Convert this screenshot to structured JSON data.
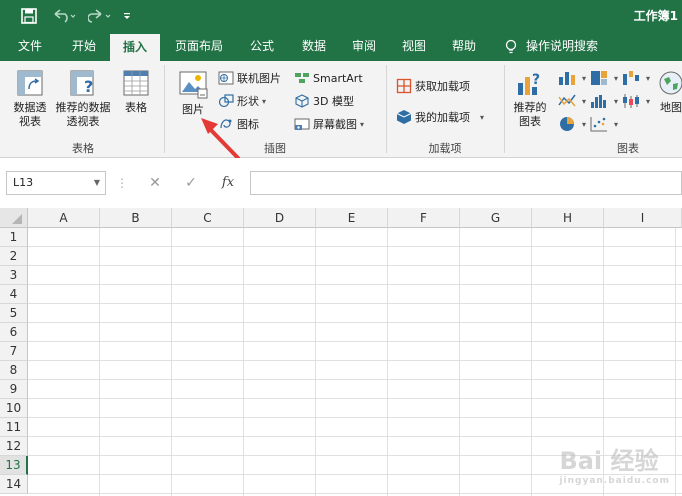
{
  "window": {
    "title": "工作簿1"
  },
  "tabs": [
    {
      "label": "文件"
    },
    {
      "label": "开始"
    },
    {
      "label": "插入"
    },
    {
      "label": "页面布局"
    },
    {
      "label": "公式"
    },
    {
      "label": "数据"
    },
    {
      "label": "审阅"
    },
    {
      "label": "视图"
    },
    {
      "label": "帮助"
    },
    {
      "label": "操作说明搜索"
    }
  ],
  "active_tab": "插入",
  "ribbon": {
    "tables": {
      "pivot": "数据透视表",
      "recommended_pivot": "推荐的数据透视表",
      "table": "表格",
      "group_label": "表格"
    },
    "illustrations": {
      "picture": "图片",
      "online_picture": "联机图片",
      "shapes": "形状",
      "icons": "图标",
      "smartart": "SmartArt",
      "model3d": "3D 模型",
      "screenshot": "屏幕截图",
      "group_label": "插图"
    },
    "addins": {
      "get": "获取加载项",
      "my": "我的加载项",
      "group_label": "加载项"
    },
    "charts": {
      "recommended": "推荐的图表",
      "maps": "地图",
      "group_label": "图表"
    }
  },
  "formula_bar": {
    "name_box": "L13",
    "fx": "fx",
    "formula": ""
  },
  "columns": [
    "A",
    "B",
    "C",
    "D",
    "E",
    "F",
    "G",
    "H",
    "I"
  ],
  "rows": [
    "1",
    "2",
    "3",
    "4",
    "5",
    "6",
    "7",
    "8",
    "9",
    "10",
    "11",
    "12",
    "13",
    "14"
  ],
  "selected_row": "13",
  "watermark": {
    "text": "Bai 经验",
    "sub": "jingyan.baidu.com"
  },
  "colors": {
    "accent": "#217346",
    "arrow": "#e53935"
  }
}
